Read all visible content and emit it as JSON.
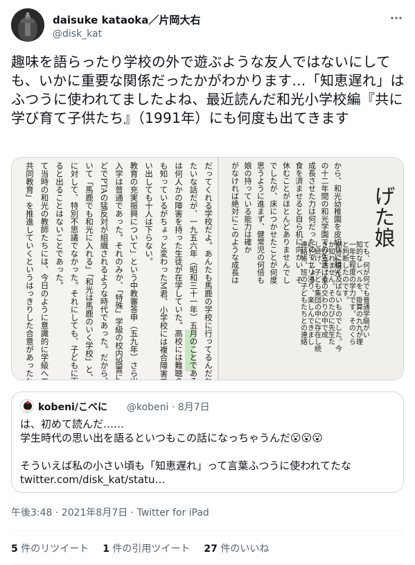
{
  "author": {
    "name": "daisuke kataoka／片岡大右",
    "handle": "@disk_kat"
  },
  "tweet": {
    "text": "趣味を語らったり学校の外で遊ぶような友人ではないにしても、いかに重要な関係だったかがわかります…「知恵遅れ」はふつうに使われてましたよね、最近読んだ和光小学校編『共に学び育て子供たち』（1991年）にも何度も出てきます"
  },
  "media": {
    "alt_heading": "げた娘",
    "column_lines": [
      "だってくれる学校だよ。あんたも馬鹿の学校に行ってるんだね」と言われ",
      "たいな話だが、一九五六年（昭和三十一年）五月のことである。",
      "は何人かの障害を持った生徒が在学していた。高校には難聴のK君、中学",
      "も知っているがちょっと変わったM君、小学校には複合障害で知恵遅れの",
      "い出しても十人は下らない。",
      "教育の充実振興について」という中教審答申（五九年）さら出ていくし",
      "入学は普通であった。それのみか、「特殊」学級の校内設置に対しては",
      "どでPTAの猛反対が組織されるような時代であった。だから、障害児が",
      "いて「馬鹿でも和光に入れる」「和光は馬鹿のいく学校」と、心ない",
      "に対して、特別不思議でなかった。それにしても、子どもに面と向かって",
      "ると出ることはないことであった。",
      "て当時の和光の教師たちには、今日のように意識的に学級へ二名の障害",
      "共同教育」を推進していくというはっきりした合意があったわけではな"
    ],
    "right_page_lines": [
      "から、和光幼稚園を皮切りに和光",
      "の十二年間の和光学園での生活は幸",
      "成長させた力は何だったのでしょう",
      "食を済ませると自ら机に向かい、そ",
      "休むことがほとんどありませんでし",
      "でしたが、床につかせたことが何度",
      "思うように進まず、健常児の何倍も",
      "娘の持っている能力は確か",
      "がなければ絶対にこのような成長は"
    ],
    "far_right_lines": [
      "ても、何が何でも普通学級がい",
      "知的なレベルを、掛算の九九が理",
      "一年生程度の学力です。そのくら",
      "と判断したのです。",
      "期待に遠く及ばないものでした。今",
      "か知れません。そのたびに先生た",
      "きひらき、その交わりの中で成",
      "し続け、子ども集団の中に存在し続",
      "にドップリ浸り、楽しんできまし",
      "連絡帳、班の子どもたちとの連絡"
    ]
  },
  "quote": {
    "name": "kobeni/こべに",
    "meta": "@kobeni · 8月7日",
    "text": "は、初めて読んだ……\n学生時代の思い出を語るといつもこの話になっちゃうんだ😮😮😮\n\nそういえば私の小さい頃も「知恵遅れ」って言葉ふつうに使われてたな\ntwitter.com/disk_kat/statu…"
  },
  "timestamp": "午後3:48 · 2021年8月7日 · Twitter for iPad",
  "stats": {
    "retweets_count": "5",
    "retweets_label": "件のリツイート",
    "quotes_count": "1",
    "quotes_label": "件の引用ツイート",
    "likes_count": "27",
    "likes_label": "件のいいね"
  }
}
